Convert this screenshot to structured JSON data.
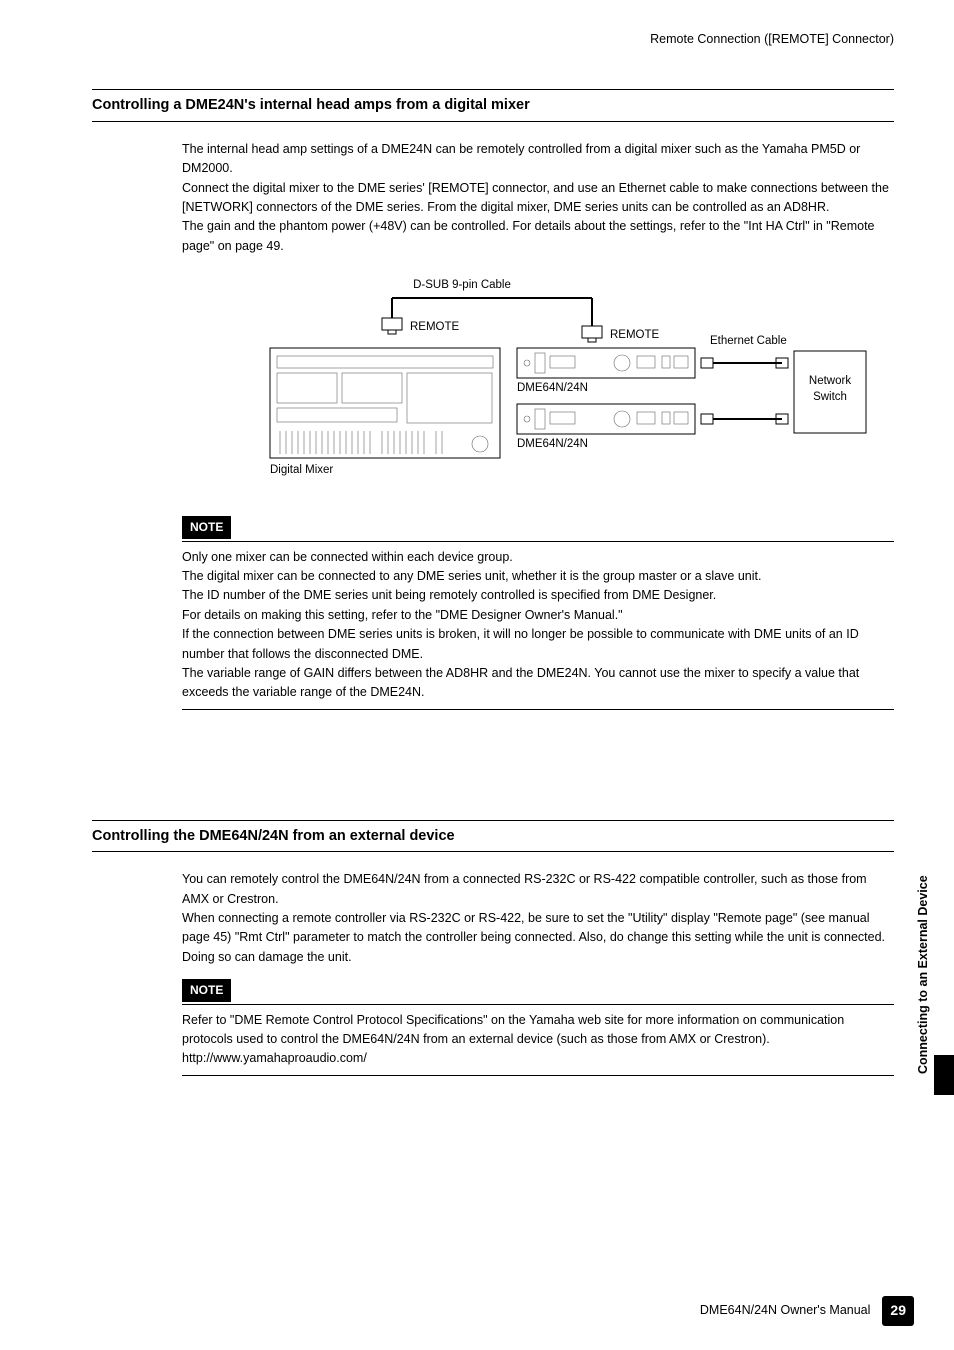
{
  "header": {
    "breadcrumb": "Remote Connection ([REMOTE] Connector)"
  },
  "section1": {
    "title": "Controlling a DME24N's internal head amps from a digital mixer",
    "p1": "The internal head amp settings of a DME24N can be remotely controlled from a digital mixer such as the Yamaha PM5D or DM2000.",
    "p2": "Connect the digital mixer to the DME series' [REMOTE] connector, and use an Ethernet cable to make connections between the [NETWORK] connectors of the DME series. From the digital mixer, DME series units can be controlled as an AD8HR.",
    "p3": "The gain and the phantom power (+48V) can be controlled. For details about the settings, refer to the \"Int HA Ctrl\" in \"Remote page\" on page 49."
  },
  "diagram": {
    "dsub_label": "D-SUB 9-pin Cable",
    "remote_label": "REMOTE",
    "ethernet_label": "Ethernet Cable",
    "network_switch_label1": "Network",
    "network_switch_label2": "Switch",
    "mixer_label": "Digital Mixer",
    "dme_label": "DME64N/24N"
  },
  "note1": {
    "label": "NOTE",
    "p1": "Only one mixer can be connected within each device group.",
    "p2": "The digital mixer can be connected to any DME series unit, whether it is the group master or a slave unit.",
    "p3": "The ID number of the DME series unit being remotely controlled is specified from DME Designer.",
    "p4": "For details on making this setting, refer to the \"DME Designer Owner's Manual.\"",
    "p5": "If the connection between DME series units is broken, it will no longer be possible to communicate with DME units of an ID number that follows the disconnected DME.",
    "p6": "The variable range of GAIN differs between the AD8HR and the DME24N. You cannot use the mixer to specify a value that exceeds the variable range of the DME24N."
  },
  "section2": {
    "title": "Controlling the DME64N/24N from an external device",
    "p1": "You can remotely control the DME64N/24N from a connected RS-232C or RS-422 compatible controller, such as those from AMX or Crestron.",
    "p2": "When connecting a remote controller via RS-232C or RS-422, be sure to set the \"Utility\" display \"Remote page\" (see manual page 45) \"Rmt Ctrl\" parameter to match the controller being connected. Also, do change this setting while the unit is connected. Doing so can damage the unit."
  },
  "note2": {
    "label": "NOTE",
    "p1": "Refer to \"DME Remote Control Protocol Specifications\" on the Yamaha web site for more information on communication protocols used to control the DME64N/24N from an external device (such as those from AMX or Crestron).",
    "p2": "http://www.yamahaproaudio.com/"
  },
  "sidetab": {
    "label": "Connecting to an External Device"
  },
  "footer": {
    "manual": "DME64N/24N Owner's Manual",
    "page": "29"
  }
}
